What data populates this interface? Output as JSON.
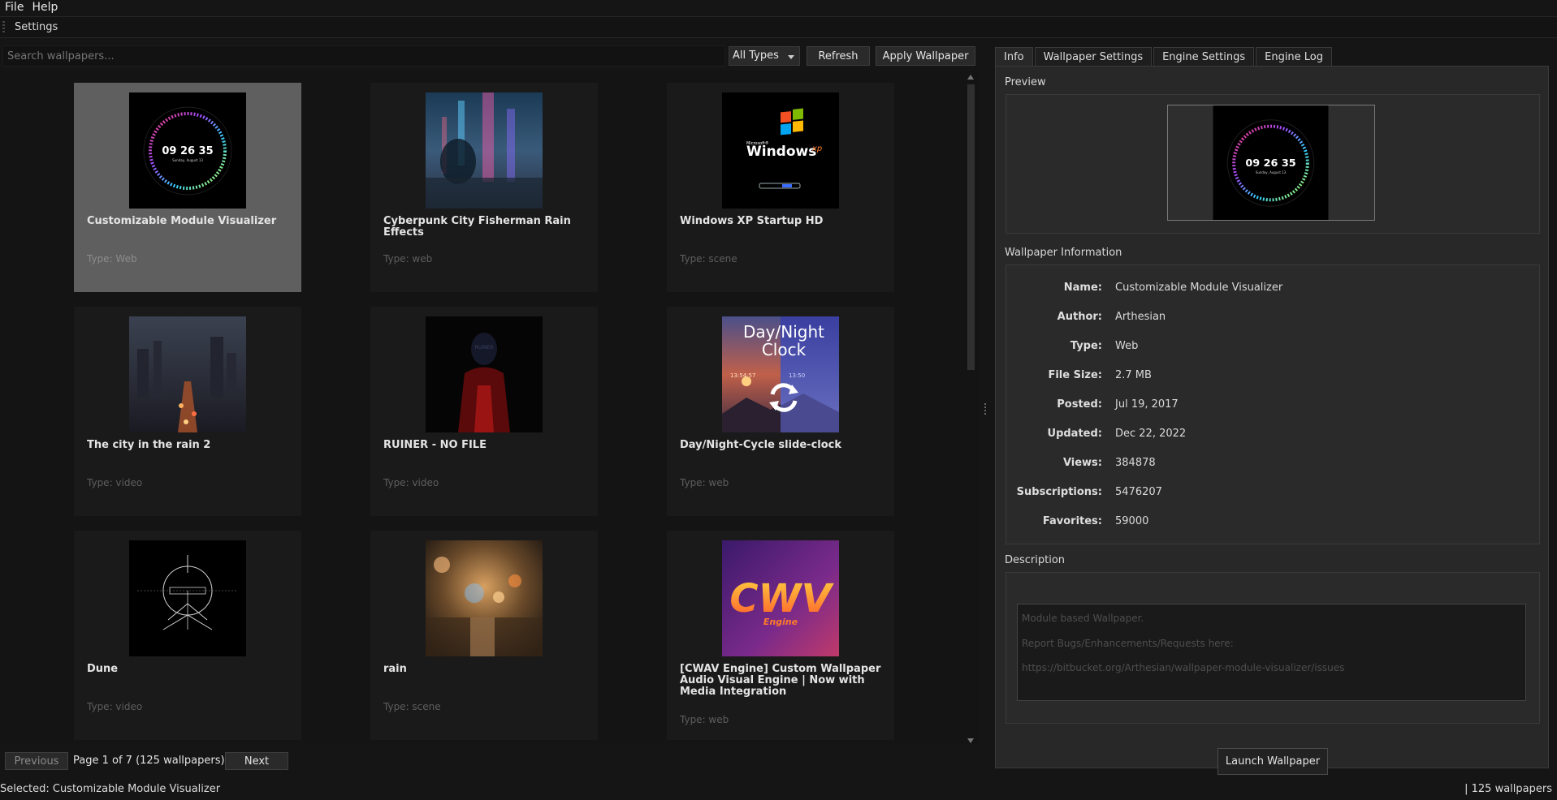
{
  "menu": {
    "file": "File",
    "help": "Help"
  },
  "toolbar": {
    "settings": "Settings"
  },
  "search": {
    "placeholder": "Search wallpapers..."
  },
  "filter": {
    "selected": "All Types"
  },
  "actions": {
    "refresh": "Refresh",
    "apply": "Apply Wallpaper"
  },
  "wallpapers": [
    {
      "title": "Customizable Module Visualizer",
      "type": "Type: Web",
      "selected": true
    },
    {
      "title": "Cyberpunk City Fisherman Rain Effects",
      "type": "Type: web",
      "selected": false
    },
    {
      "title": "Windows XP Startup HD",
      "type": "Type: scene",
      "selected": false
    },
    {
      "title": "The city in the rain 2",
      "type": "Type: video",
      "selected": false
    },
    {
      "title": "RUINER - NO FILE",
      "type": "Type: video",
      "selected": false
    },
    {
      "title": "Day/Night-Cycle slide-clock",
      "type": "Type: web",
      "selected": false
    },
    {
      "title": "Dune",
      "type": "Type: video",
      "selected": false
    },
    {
      "title": "rain",
      "type": "Type: scene",
      "selected": false
    },
    {
      "title": "[CWAV Engine] Custom Wallpaper Audio Visual Engine | Now with Media Integration",
      "type": "Type: web",
      "selected": false
    }
  ],
  "thumbs": {
    "clock_time": "09 26 35",
    "clock_date": "Sunday, August 13",
    "xp_brand": "Microsoft®",
    "xp_word": "Windows",
    "xp_suffix": "xp",
    "ruiner_text": "RUINER",
    "daynight_line1": "Day/Night",
    "daynight_line2": "Clock",
    "daynight_t1": "13:54:57",
    "daynight_t2": "13:50",
    "cwav_logo": "CWV",
    "cwav_sub": "Engine"
  },
  "pager": {
    "previous": "Previous",
    "info": "Page 1 of 7 (125 wallpapers)",
    "next": "Next"
  },
  "tabs": {
    "info": "Info",
    "wallpaper_settings": "Wallpaper Settings",
    "engine_settings": "Engine Settings",
    "engine_log": "Engine Log"
  },
  "preview": {
    "title": "Preview"
  },
  "info": {
    "title": "Wallpaper Information",
    "rows": [
      {
        "label": "Name:",
        "value": "Customizable Module Visualizer"
      },
      {
        "label": "Author:",
        "value": "Arthesian"
      },
      {
        "label": "Type:",
        "value": "Web"
      },
      {
        "label": "File Size:",
        "value": "2.7 MB"
      },
      {
        "label": "Posted:",
        "value": "Jul 19, 2017"
      },
      {
        "label": "Updated:",
        "value": "Dec 22, 2022"
      },
      {
        "label": "Views:",
        "value": "384878"
      },
      {
        "label": "Subscriptions:",
        "value": "5476207"
      },
      {
        "label": "Favorites:",
        "value": "59000"
      }
    ]
  },
  "description": {
    "title": "Description",
    "lines": [
      "Module based Wallpaper.",
      "Report Bugs/Enhancements/Requests here:",
      "https://bitbucket.org/Arthesian/wallpaper-module-visualizer/issues"
    ]
  },
  "launch": {
    "label": "Launch Wallpaper"
  },
  "status": {
    "selected": "Selected: Customizable Module Visualizer",
    "count": "|  125 wallpapers"
  }
}
